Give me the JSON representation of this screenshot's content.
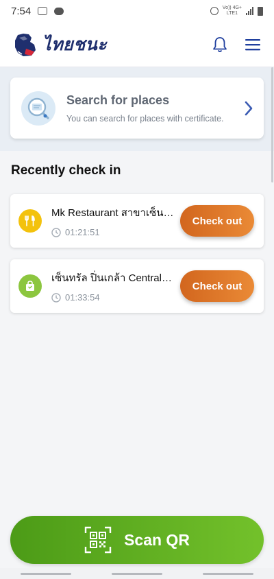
{
  "status_bar": {
    "time": "7:54",
    "network_top": "Vo)) 4G+",
    "network_bottom": "LTE1"
  },
  "header": {
    "app_name": "ไทยชนะ",
    "logo_icon": "fist-logo-icon",
    "notification_icon": "bell-icon",
    "menu_icon": "hamburger-menu-icon",
    "brand_color": "#1f2f6e"
  },
  "search": {
    "title": "Search for places",
    "subtitle": "You can search for places with certificate.",
    "icon": "search-certificate-icon"
  },
  "recent": {
    "title": "Recently check in",
    "items": [
      {
        "name": "Mk Restaurant สาขาเซ็นทรัล ปิ่นเกล้า",
        "elapsed": "01:21:51",
        "category_icon": "restaurant-icon",
        "button": "Check out"
      },
      {
        "name": "เซ็นทรัล ปิ่นเกล้า Central Pinklao",
        "elapsed": "01:33:54",
        "category_icon": "shopping-bag-icon",
        "button": "Check out"
      }
    ]
  },
  "scan": {
    "label": "Scan QR",
    "icon": "qr-code-icon"
  },
  "colors": {
    "accent_orange": "#e07a2c",
    "scan_green": "#5fae22",
    "food_yellow": "#f3c20d",
    "shop_green": "#8cc63f"
  }
}
